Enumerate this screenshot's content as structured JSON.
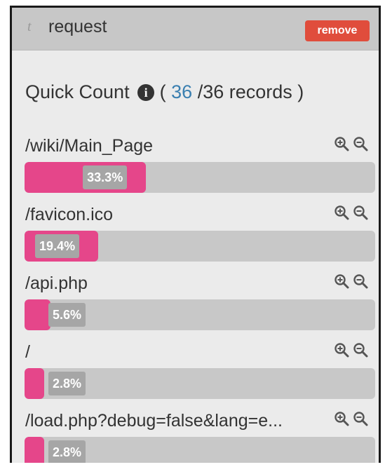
{
  "header": {
    "type_icon": "t",
    "field_name": "request",
    "remove_label": "remove"
  },
  "quick_count": {
    "title": "Quick Count",
    "open": "(",
    "count": "36",
    "total": "/36 records",
    "close": ")"
  },
  "rows": [
    {
      "label": "/wiki/Main_Page",
      "percent_text": "33.3%",
      "percent": 33.3
    },
    {
      "label": "/favicon.ico",
      "percent_text": "19.4%",
      "percent": 19.4
    },
    {
      "label": "/api.php",
      "percent_text": "5.6%",
      "percent": 5.6
    },
    {
      "label": "/",
      "percent_text": "2.8%",
      "percent": 2.8
    },
    {
      "label": "/load.php?debug=false&lang=e...",
      "percent_text": "2.8%",
      "percent": 2.8
    }
  ],
  "icons": {
    "zoom_in": "zoom-in-icon",
    "zoom_out": "zoom-out-icon",
    "info": "info-icon"
  },
  "colors": {
    "accent": "#e5468a",
    "remove": "#e04d3c",
    "count": "#3a7fb0",
    "track": "#c8c8c8"
  }
}
